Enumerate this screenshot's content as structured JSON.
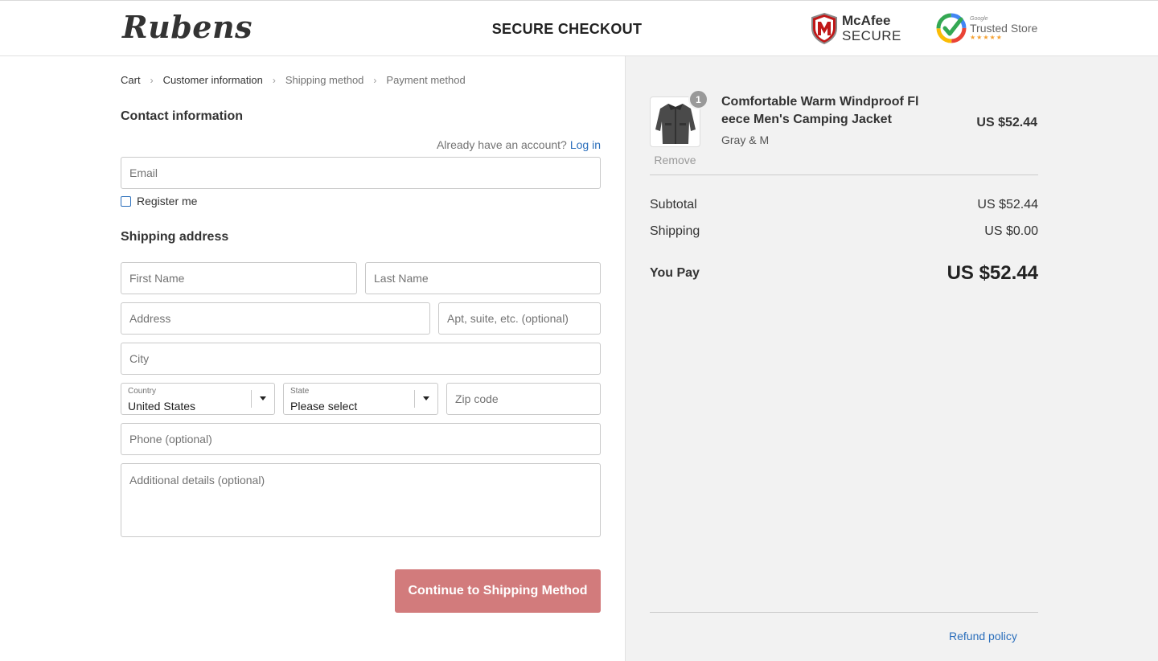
{
  "header": {
    "logo": "Rubens",
    "title": "SECURE CHECKOUT",
    "mcafee_brand": "McAfee",
    "mcafee_secure": "SECURE",
    "gts_google": "Google",
    "gts_label": "Trusted Store",
    "gts_stars": "★★★★★"
  },
  "breadcrumb": {
    "items": [
      "Cart",
      "Customer information",
      "Shipping method",
      "Payment method"
    ],
    "separator": "›"
  },
  "contact": {
    "title": "Contact information",
    "account_prompt": "Already have an account?",
    "login_link": "Log in",
    "email_placeholder": "Email",
    "register_label": "Register me"
  },
  "shipping": {
    "title": "Shipping address",
    "first_name_placeholder": "First Name",
    "last_name_placeholder": "Last Name",
    "address_placeholder": "Address",
    "apt_placeholder": "Apt, suite, etc. (optional)",
    "city_placeholder": "City",
    "country_label": "Country",
    "country_value": "United States",
    "state_label": "State",
    "state_value": "Please select",
    "zip_placeholder": "Zip code",
    "phone_placeholder": "Phone (optional)",
    "details_placeholder": "Additional details (optional)",
    "continue_label": "Continue to Shipping Method"
  },
  "order": {
    "product_name": "Comfortable Warm Windproof Fleece Men's Camping Jacket",
    "product_name_line1": "Comfortable Warm Windproof Fl",
    "product_name_line2": "eece Men's Camping Jacket",
    "variant": "Gray & M",
    "quantity": "1",
    "price": "US $52.44",
    "remove_label": "Remove",
    "subtotal_label": "Subtotal",
    "subtotal_value": "US $52.44",
    "shipping_label": "Shipping",
    "shipping_value": "US $0.00",
    "total_label": "You Pay",
    "total_value": "US $52.44",
    "refund_link": "Refund policy"
  },
  "colors": {
    "accent_link": "#2a6ebb",
    "button": "#d27b7c",
    "sidebar_bg": "#f2f2f2"
  }
}
